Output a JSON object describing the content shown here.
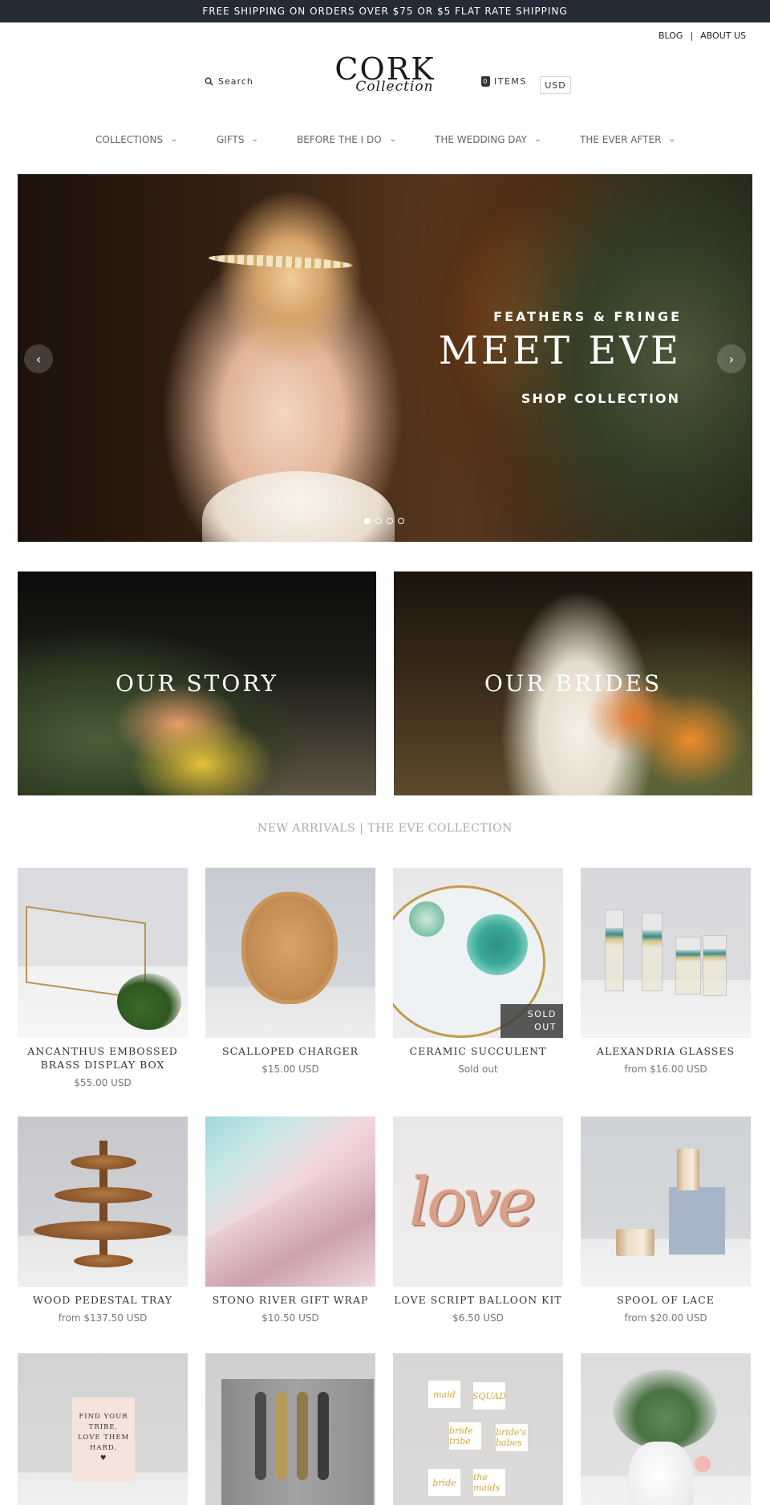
{
  "announcement": "FREE SHIPPING ON ORDERS OVER $75 OR $5 FLAT RATE SHIPPING",
  "top_links": {
    "blog": "BLOG",
    "separator": "|",
    "about": "ABOUT US"
  },
  "search": {
    "label": "Search",
    "icon": "search-icon"
  },
  "logo": {
    "line1": "CORK",
    "line2": "Collection"
  },
  "cart": {
    "label": "ITEMS",
    "count": "0",
    "icon": "shopping-bag-icon"
  },
  "currency": "USD",
  "nav": {
    "items": [
      {
        "label": "COLLECTIONS"
      },
      {
        "label": "GIFTS"
      },
      {
        "label": "BEFORE THE I DO"
      },
      {
        "label": "THE WEDDING DAY"
      },
      {
        "label": "THE EVER AFTER"
      }
    ],
    "chevron": "⌄"
  },
  "hero": {
    "subtitle": "FEATHERS & FRINGE",
    "title": "MEET EVE",
    "cta": "SHOP COLLECTION",
    "prev_icon": "‹",
    "next_icon": "›",
    "slides": 4,
    "active_slide": 1
  },
  "promos": {
    "story": "OUR STORY",
    "brides": "OUR BRIDES"
  },
  "section_title": "NEW ARRIVALS | THE EVE COLLECTION",
  "products": [
    {
      "name": "ANCANTHUS EMBOSSED BRASS DISPLAY BOX",
      "price": "$55.00 USD"
    },
    {
      "name": "SCALLOPED CHARGER",
      "price": "$15.00 USD"
    },
    {
      "name": "CERAMIC SUCCULENT",
      "price": "Sold out",
      "badge": "SOLD OUT"
    },
    {
      "name": "ALEXANDRIA GLASSES",
      "price": "from $16.00 USD"
    },
    {
      "name": "WOOD PEDESTAL TRAY",
      "price": "from $137.50 USD"
    },
    {
      "name": "STONO RIVER GIFT WRAP",
      "price": "$10.50 USD"
    },
    {
      "name": "LOVE SCRIPT BALLOON KIT",
      "price": "$6.50 USD"
    },
    {
      "name": "SPOOL OF LACE",
      "price": "from $20.00 USD"
    }
  ],
  "product_images": {
    "balloon_text": "love",
    "card_text": [
      "FIND YOUR",
      "TRIBE,",
      "LOVE THEM",
      "HARD."
    ],
    "card_heart": "♥",
    "signs": [
      "maid",
      "SQUAD",
      "bride tribe",
      "bride's babes",
      "bride",
      "the maids"
    ]
  },
  "colors": {
    "announcement_bg": "#242a36",
    "text": "#333333",
    "muted": "#777777",
    "section_title": "#aaaaaa"
  }
}
